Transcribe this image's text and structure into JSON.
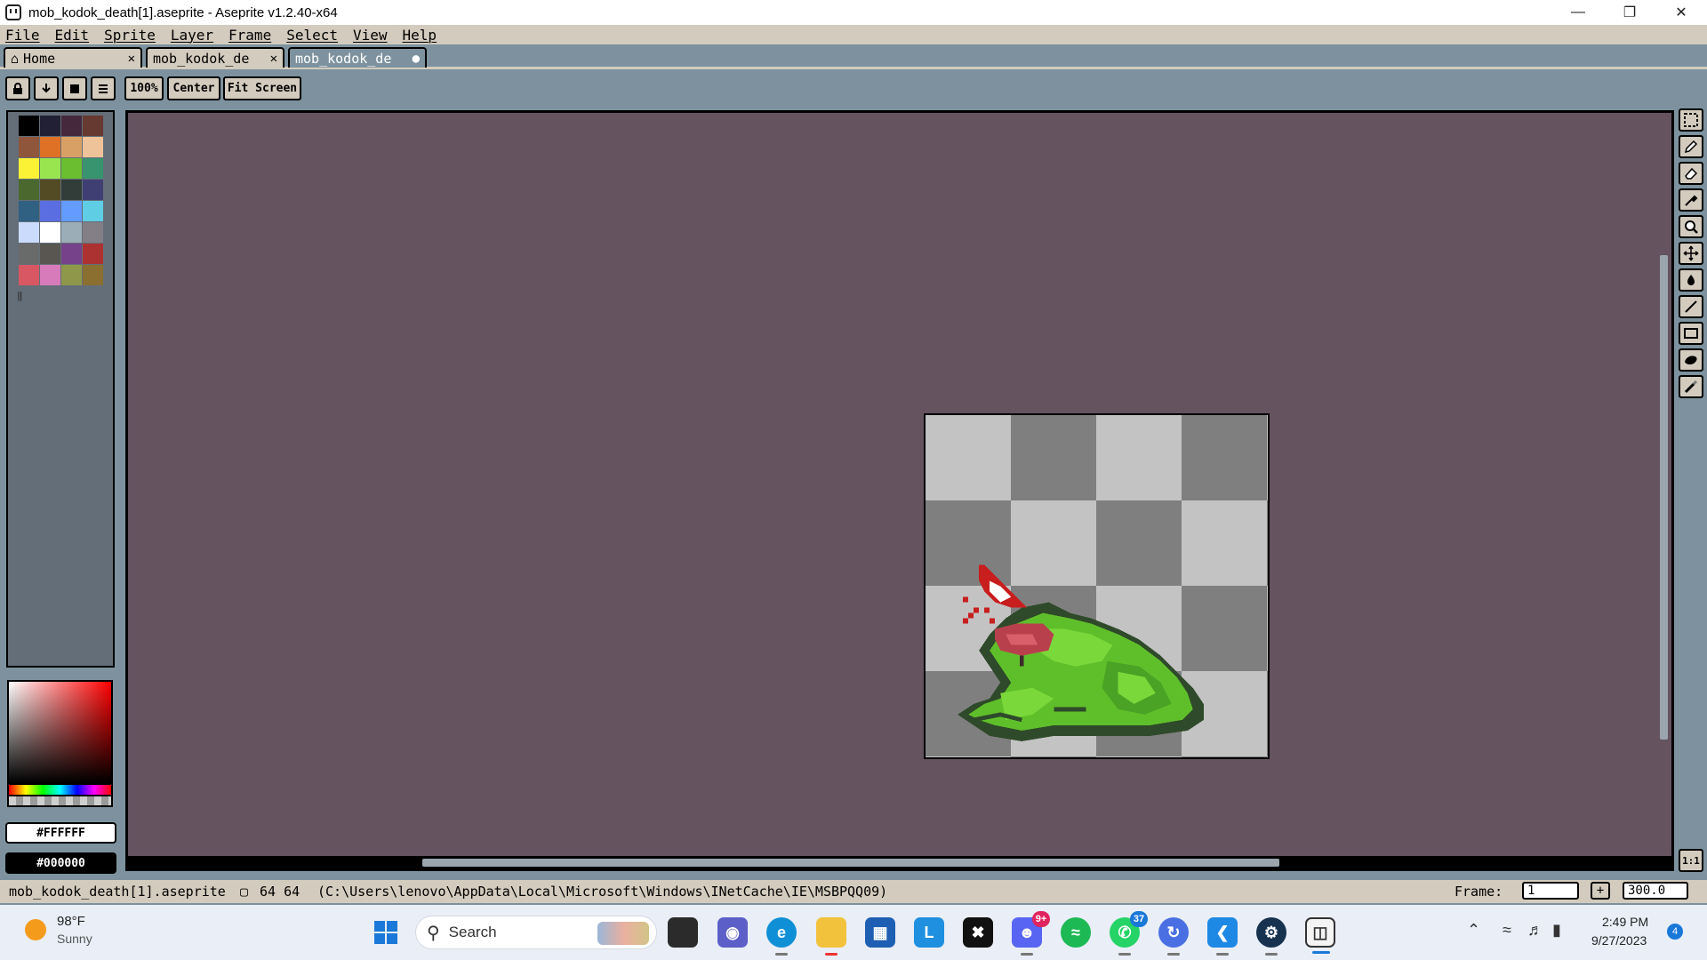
{
  "window": {
    "title": "mob_kodok_death[1].aseprite - Aseprite v1.2.40-x64",
    "minimize": "—",
    "restore": "❐",
    "close": "✕"
  },
  "menu": [
    "File",
    "Edit",
    "Sprite",
    "Layer",
    "Frame",
    "Select",
    "View",
    "Help"
  ],
  "tabs": [
    {
      "label": "Home",
      "close": "✕"
    },
    {
      "label": "mob_kodok_de",
      "close": "✕"
    },
    {
      "label": "mob_kodok_de",
      "close": "●"
    }
  ],
  "toolbar": {
    "zoom_label": "100%",
    "center_label": "Center",
    "fit_label": "Fit Screen"
  },
  "palette": {
    "colors": [
      "#000000",
      "#222034",
      "#45283c",
      "#663931",
      "#8f563b",
      "#df7126",
      "#d9a066",
      "#eec39a",
      "#fbf236",
      "#99e550",
      "#6abe30",
      "#37946e",
      "#4b692f",
      "#524b24",
      "#323c39",
      "#3f3f74",
      "#306082",
      "#5b6ee1",
      "#639bff",
      "#5fcde4",
      "#cbdbfc",
      "#ffffff",
      "#9badb7",
      "#847e87",
      "#696a6a",
      "#595652",
      "#76428a",
      "#ac3232",
      "#d95763",
      "#d77bba",
      "#8f974a",
      "#8a6f30"
    ]
  },
  "colors": {
    "foreground": "#FFFFFF",
    "background": "#000000"
  },
  "tools": [
    "marquee-tool-icon",
    "pencil-tool-icon",
    "eraser-tool-icon",
    "eyedropper-tool-icon",
    "zoom-tool-icon",
    "move-tool-icon",
    "paint-bucket-tool-icon",
    "line-tool-icon",
    "rectangle-tool-icon",
    "contour-tool-icon",
    "blur-tool-icon"
  ],
  "one_to_one": "1:1",
  "status": {
    "filename": "mob_kodok_death[1].aseprite",
    "size": "64 64",
    "path": "(C:\\Users\\lenovo\\AppData\\Local\\Microsoft\\Windows\\INetCache\\IE\\MSBPQQ09)",
    "frame_label": "Frame:",
    "frame_value": "1",
    "zoom_value": "300.0"
  },
  "taskbar": {
    "weather_temp": "98°F",
    "weather_desc": "Sunny",
    "search_placeholder": "Search",
    "time": "2:49 PM",
    "date": "9/27/2023",
    "notification_count": "4",
    "discord_badge": "9+",
    "whatsapp_badge": "37"
  }
}
